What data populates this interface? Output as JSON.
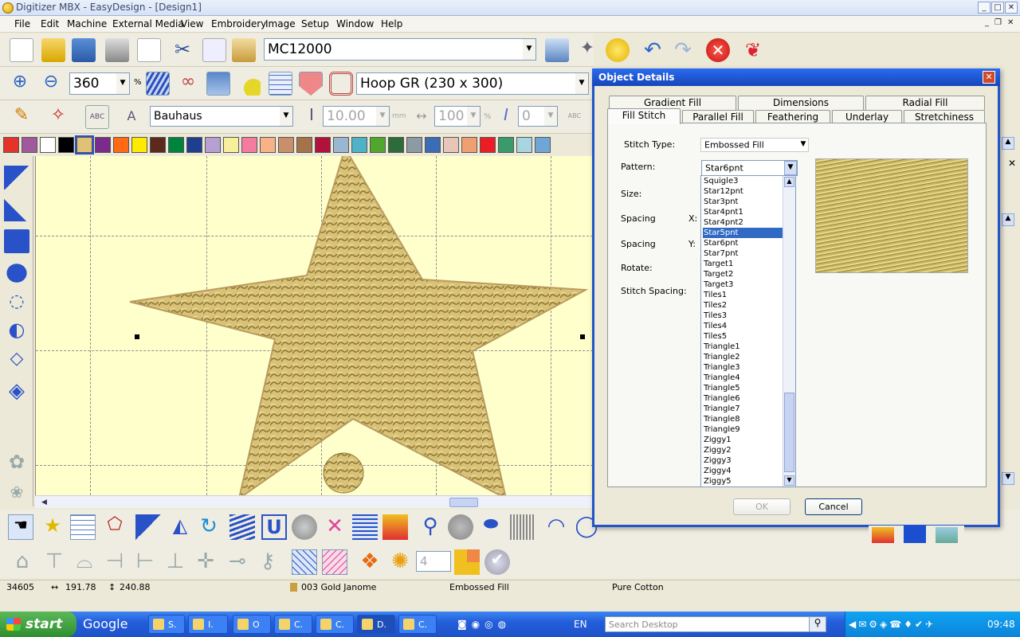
{
  "window": {
    "title": "Digitizer MBX - EasyDesign - [Design1]",
    "min": "_",
    "max": "□",
    "close": "✕"
  },
  "menu": [
    "File",
    "Edit",
    "Machine",
    "External Media",
    "View",
    "Embroidery",
    "Image",
    "Setup",
    "Window",
    "Help"
  ],
  "toolbar1": {
    "machine": "MC12000"
  },
  "toolbar2": {
    "zoom": "360",
    "zoom_unit": "%",
    "hoop": "Hoop GR (230 x 300)"
  },
  "toolbar3": {
    "font": "Bauhaus",
    "height": "10.00",
    "height_unit": "mm",
    "width": "100",
    "width_unit": "%",
    "slant": "0"
  },
  "palette": [
    "#e5332a",
    "#a05a9b",
    "#ffffff",
    "#000000",
    "#e0c276",
    "#7a2b8d",
    "#ff6a13",
    "#ffea00",
    "#5c2a1a",
    "#00843d",
    "#1f3e8f",
    "#b69fd1",
    "#f7ef9c",
    "#f47c9e",
    "#f8b28a",
    "#c8906a",
    "#a6724a",
    "#b0123a",
    "#9bb6d1",
    "#4fb2c8",
    "#51a62d",
    "#2e6b3a",
    "#8e9aa3",
    "#3a6db4",
    "#e7c6b8",
    "#f0a070",
    "#ea1c24",
    "#3a9b6a",
    "#a9d5e0",
    "#6fa6d6"
  ],
  "dialog": {
    "title": "Object Details",
    "tabs_row1": [
      "Gradient Fill",
      "Dimensions",
      "Radial Fill"
    ],
    "tabs_row2": [
      "Fill Stitch",
      "Parallel Fill",
      "Feathering",
      "Underlay",
      "Stretchiness"
    ],
    "stitch_type_label": "Stitch Type:",
    "stitch_type_value": "Embossed Fill",
    "pattern_label": "Pattern:",
    "pattern_value": "Star6pnt",
    "size_label": "Size:",
    "spacing_x_label": "Spacing",
    "x_label": "X:",
    "spacing_y_label": "Spacing",
    "y_label": "Y:",
    "rotate_label": "Rotate:",
    "stitch_spacing_label": "Stitch Spacing:",
    "patterns": [
      "Squigle3",
      "Star12pnt",
      "Star3pnt",
      "Star4pnt1",
      "Star4pnt2",
      "Star5pnt",
      "Star6pnt",
      "Star7pnt",
      "Target1",
      "Target2",
      "Target3",
      "Tiles1",
      "Tiles2",
      "Tiles3",
      "Tiles4",
      "Tiles5",
      "Triangle1",
      "Triangle2",
      "Triangle3",
      "Triangle4",
      "Triangle5",
      "Triangle6",
      "Triangle7",
      "Triangle8",
      "Triangle9",
      "Ziggy1",
      "Ziggy2",
      "Ziggy3",
      "Ziggy4",
      "Ziggy5"
    ],
    "selected_pattern": "Star5pnt",
    "ok": "OK",
    "cancel": "Cancel"
  },
  "bottom": {
    "spin_value": "4"
  },
  "status": {
    "stitches": "34605",
    "width": "191.78",
    "height": "240.88",
    "thread": "003 Gold Janome",
    "fill": "Embossed Fill",
    "fabric": "Pure Cotton"
  },
  "taskbar": {
    "start": "start",
    "google": "Google",
    "tasks": [
      "S.",
      "I.",
      "O",
      "C.",
      "C.",
      "D.",
      "C."
    ],
    "lang": "EN",
    "search_placeholder": "Search Desktop",
    "time": "09:48"
  }
}
